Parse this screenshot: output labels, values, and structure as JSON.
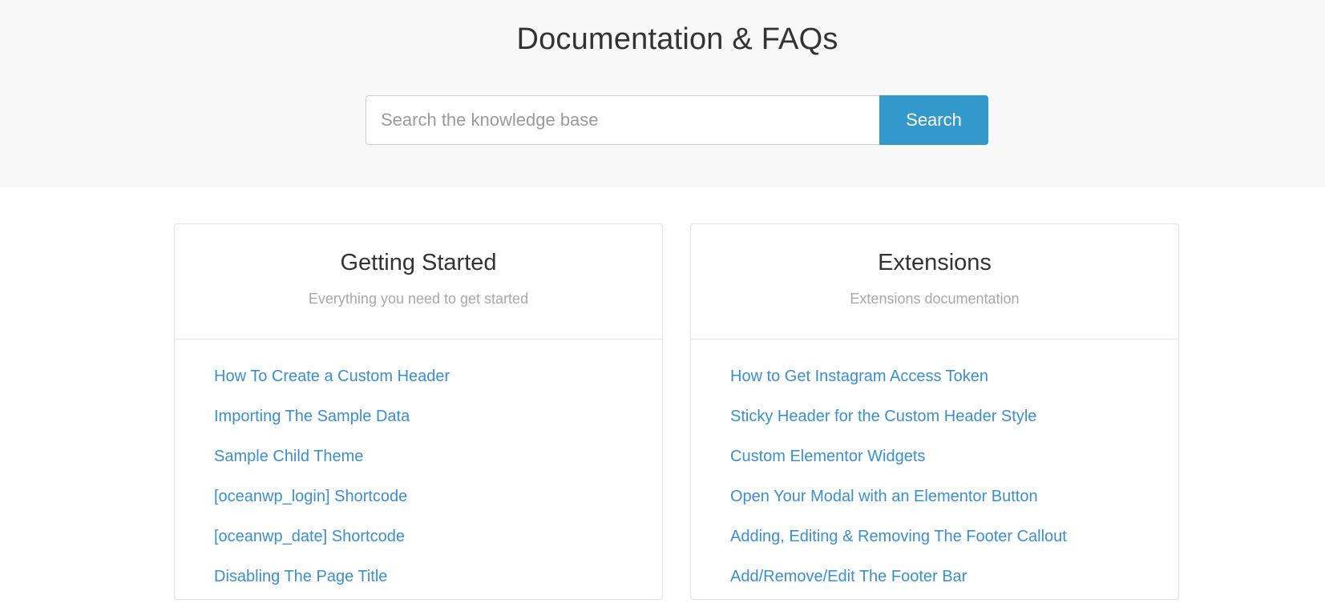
{
  "hero": {
    "title": "Documentation & FAQs",
    "search": {
      "placeholder": "Search the knowledge base",
      "value": "",
      "button_label": "Search"
    }
  },
  "categories": [
    {
      "title": "Getting Started",
      "subtitle": "Everything you need to get started",
      "links": [
        "How To Create a Custom Header",
        "Importing The Sample Data",
        "Sample Child Theme",
        "[oceanwp_login] Shortcode",
        "[oceanwp_date] Shortcode",
        "Disabling The Page Title"
      ]
    },
    {
      "title": "Extensions",
      "subtitle": "Extensions documentation",
      "links": [
        "How to Get Instagram Access Token",
        "Sticky Header for the Custom Header Style",
        "Custom Elementor Widgets",
        "Open Your Modal with an Elementor Button",
        "Adding, Editing & Removing The Footer Callout",
        "Add/Remove/Edit The Footer Bar"
      ]
    }
  ],
  "colors": {
    "accent": "#3399cc",
    "link": "#3a8fce",
    "hero_background": "#f8f8f8"
  }
}
